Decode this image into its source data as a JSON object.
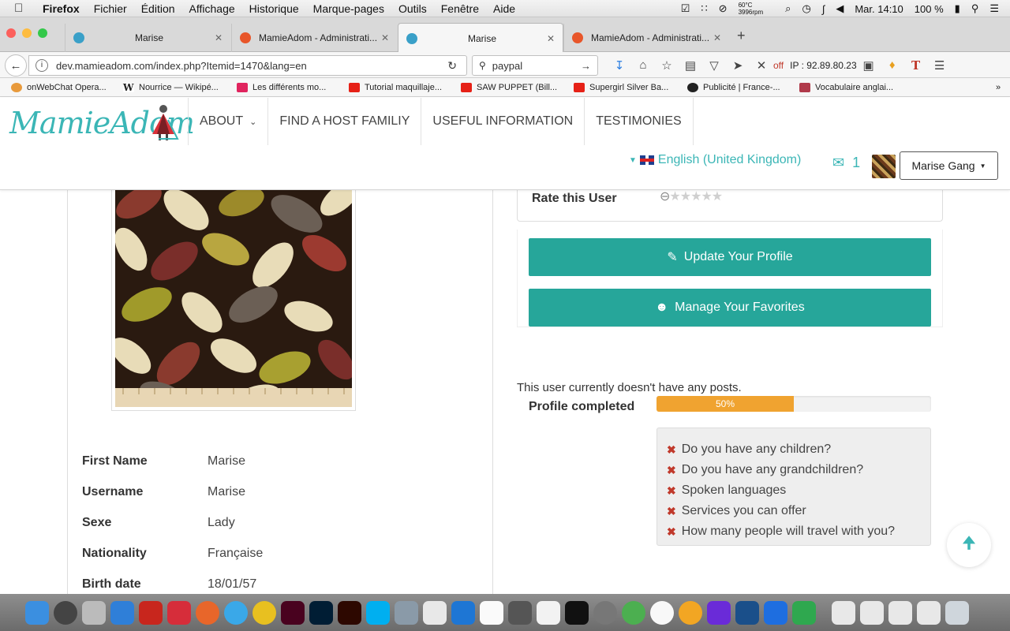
{
  "menubar": {
    "app": "Firefox",
    "items": [
      "Fichier",
      "Édition",
      "Affichage",
      "Historique",
      "Marque-pages",
      "Outils",
      "Fenêtre",
      "Aide"
    ],
    "temp_c": "60°C",
    "temp_rpm": "3996rpm",
    "clock": "Mar. 14:10",
    "battery": "100 %"
  },
  "tabs": [
    {
      "title": "Marise",
      "color": "#3aa0c8"
    },
    {
      "title": "MamieAdom - Administrati...",
      "color": "#e8562a"
    },
    {
      "title": "Marise",
      "color": "#3aa0c8"
    },
    {
      "title": "MamieAdom - Administrati...",
      "color": "#e8562a"
    }
  ],
  "nav": {
    "url": "dev.mamieadom.com/index.php?Itemid=1470&lang=en",
    "search_value": "paypal",
    "off_label": "off",
    "ip_label": "IP : 92.89.80.23"
  },
  "bookmarks": [
    "onWebChat Opera...",
    "Nourrice — Wikipé...",
    "Les différents mo...",
    "Tutorial maquillaje...",
    "SAW PUPPET (Bill...",
    "Supergirl Silver Ba...",
    "Publicité | France-...",
    "Vocabulaire anglai..."
  ],
  "site": {
    "logo": "MamieAdom",
    "nav": [
      "ABOUT",
      "FIND A HOST FAMILIY",
      "USEFUL INFORMATION",
      "TESTIMONIES"
    ],
    "language": "English (United Kingdom)",
    "messages_count": "1",
    "user_button": "Marise Gang"
  },
  "profile": {
    "rate_label": "Rate this User",
    "update_button": "Update Your Profile",
    "favorites_button": "Manage Your Favorites",
    "no_posts": "This user currently doesn't have any posts.",
    "completed_label": "Profile completed",
    "completed_pct": 50,
    "completed_text": "50%",
    "missing": [
      "Do you have any children?",
      "Do you have any grandchildren?",
      "Spoken languages",
      "Services you can offer",
      "How many people will travel with you?"
    ],
    "fields": [
      {
        "label": "First Name",
        "value": "Marise"
      },
      {
        "label": "Username",
        "value": "Marise"
      },
      {
        "label": "Sexe",
        "value": "Lady"
      },
      {
        "label": "Nationality",
        "value": "Française"
      },
      {
        "label": "Birth date",
        "value": "18/01/57"
      }
    ]
  },
  "colors": {
    "teal": "#26a69a",
    "logo": "#3bb6b6",
    "progress": "#f0a330"
  }
}
